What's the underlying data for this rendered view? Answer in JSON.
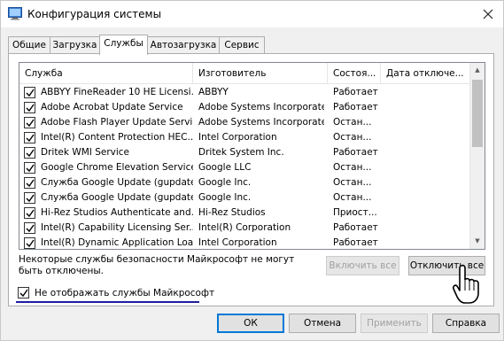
{
  "window": {
    "title": "Конфигурация системы",
    "icons": {
      "app": "system-config-icon",
      "close": "close-icon"
    }
  },
  "tabs": [
    {
      "label": "Общие",
      "active": false
    },
    {
      "label": "Загрузка",
      "active": false
    },
    {
      "label": "Службы",
      "active": true
    },
    {
      "label": "Автозагрузка",
      "active": false
    },
    {
      "label": "Сервис",
      "active": false
    }
  ],
  "services": {
    "columns": {
      "service": "Служба",
      "manufacturer": "Изготовитель",
      "status": "Состоя...",
      "disabled_date": "Дата отключе..."
    },
    "rows": [
      {
        "checked": true,
        "service": "ABBYY FineReader 10 HE Licensi...",
        "manufacturer": "ABBYY",
        "status": "Работает",
        "disabled_date": ""
      },
      {
        "checked": true,
        "service": "Adobe Acrobat Update Service",
        "manufacturer": "Adobe Systems Incorporated",
        "status": "Работает",
        "disabled_date": ""
      },
      {
        "checked": true,
        "service": "Adobe Flash Player Update Service",
        "manufacturer": "Adobe Systems Incorporated",
        "status": "Остан...",
        "disabled_date": ""
      },
      {
        "checked": true,
        "service": "Intel(R) Content Protection HEC...",
        "manufacturer": "Intel Corporation",
        "status": "Остан...",
        "disabled_date": ""
      },
      {
        "checked": true,
        "service": "Dritek WMI Service",
        "manufacturer": "Dritek System Inc.",
        "status": "Работает",
        "disabled_date": ""
      },
      {
        "checked": true,
        "service": "Google Chrome Elevation Service",
        "manufacturer": "Google LLC",
        "status": "Остан...",
        "disabled_date": ""
      },
      {
        "checked": true,
        "service": "Служба Google Update (gupdate)",
        "manufacturer": "Google Inc.",
        "status": "Остан...",
        "disabled_date": ""
      },
      {
        "checked": true,
        "service": "Служба Google Update (gupdate...",
        "manufacturer": "Google Inc.",
        "status": "Остан...",
        "disabled_date": ""
      },
      {
        "checked": true,
        "service": "Hi-Rez Studios Authenticate and...",
        "manufacturer": "Hi-Rez Studios",
        "status": "Приост...",
        "disabled_date": ""
      },
      {
        "checked": true,
        "service": "Intel(R) Capability Licensing Ser...",
        "manufacturer": "Intel(R) Corporation",
        "status": "Работает",
        "disabled_date": ""
      },
      {
        "checked": true,
        "service": "Intel(R) Dynamic Application Loa...",
        "manufacturer": "Intel Corporation",
        "status": "Работает",
        "disabled_date": ""
      }
    ],
    "scroll_icons": {
      "up": "scroll-up-arrow-icon",
      "down": "scroll-down-arrow-icon"
    }
  },
  "notice": "Некоторые службы безопасности Майкрософт не могут быть отключены.",
  "buttons": {
    "enable_all": "Включить все",
    "disable_all": "Отключить все",
    "ok": "ОК",
    "cancel": "Отмена",
    "apply": "Применить",
    "help": "Справка"
  },
  "hide_microsoft": {
    "checked": true,
    "label": "Не отображать службы Майкрософт"
  },
  "cursor": "hand-pointer-icon"
}
